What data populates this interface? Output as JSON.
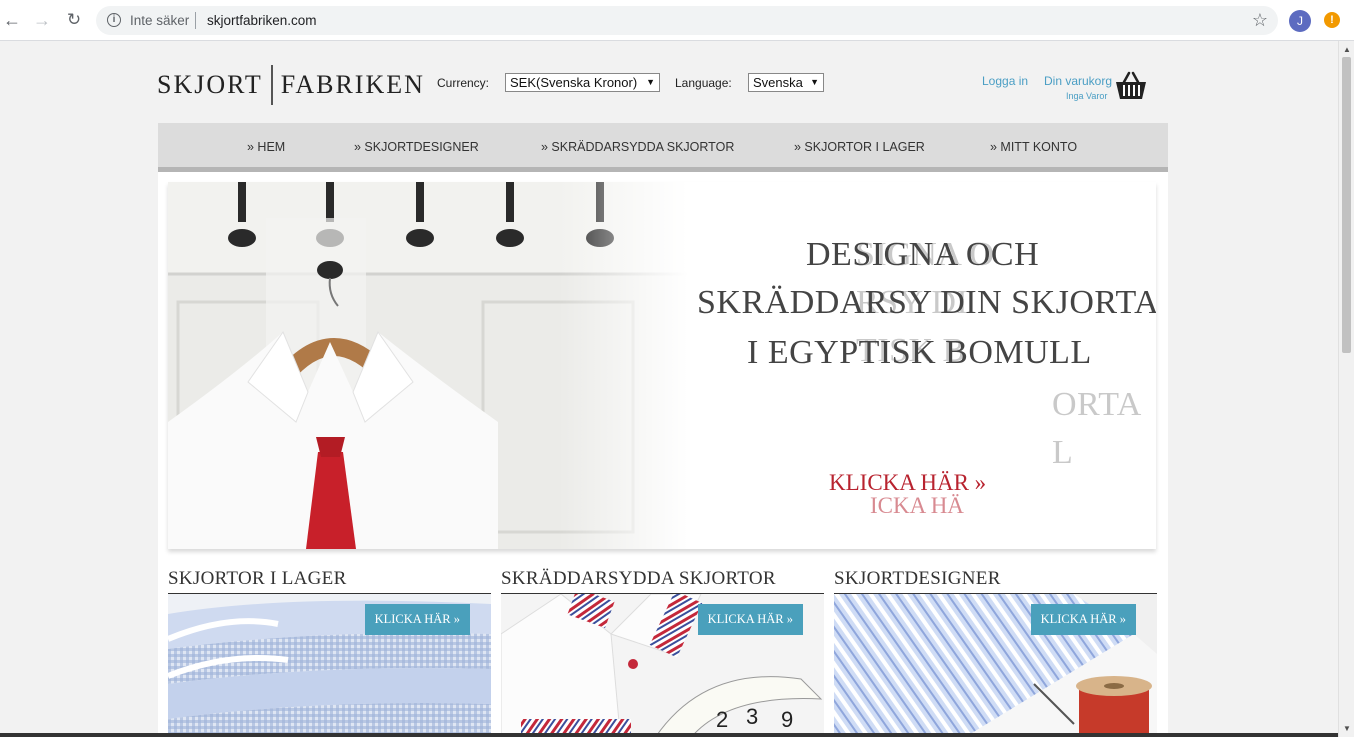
{
  "browser": {
    "security_label": "Inte säker",
    "url": "skjortfabriken.com",
    "avatar_initial": "J",
    "alert_glyph": "!"
  },
  "header": {
    "logo_left": "SKJORT",
    "logo_right": "FABRIKEN",
    "currency_label": "Currency:",
    "currency_value": "SEK(Svenska Kronor)",
    "language_label": "Language:",
    "language_value": "Svenska",
    "login_label": "Logga in",
    "cart_label": "Din varukorg",
    "cart_status": "Inga Varor",
    "basket_icon": "basket-icon"
  },
  "nav": {
    "items": [
      "» HEM",
      "» SKJORTDESIGNER",
      "» SKRÄDDARSYDDA SKJORTOR",
      "» SKJORTOR I LAGER",
      "» MITT KONTO"
    ]
  },
  "hero": {
    "lines_main": [
      "DESIGNA OCH",
      "SKRÄDDARSY DIN SKJORTA",
      "I EGYPTISK BOMULL"
    ],
    "lines_ghost": [
      "SIGNA O",
      "RSY DI",
      "TISK B",
      "ORTA",
      "L"
    ],
    "cta_main": "KLICKA HÄR »",
    "cta_ghost": "ICKA HÄ"
  },
  "sections": [
    {
      "title": "SKJORTOR I LAGER",
      "button": "KLICKA HÄR »"
    },
    {
      "title": "SKRÄDDARSYDDA SKJORTOR",
      "button": "KLICKA HÄR »"
    },
    {
      "title": "SKJORTDESIGNER",
      "button": "KLICKA HÄR »"
    }
  ],
  "colors": {
    "accent_blue": "#4aa0bc",
    "link_blue": "#4a9ec4",
    "cta_red": "#b8232f",
    "nav_gray": "#dcdcdc"
  }
}
